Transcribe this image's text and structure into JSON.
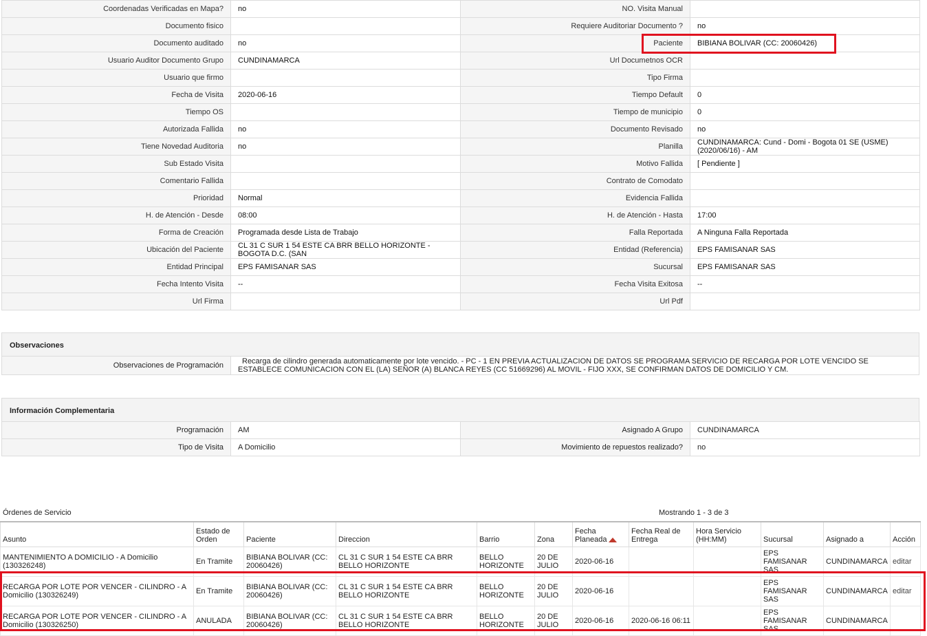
{
  "detail": {
    "rows": [
      [
        "Coordenadas Verificadas en Mapa?",
        "no",
        "NO. Visita Manual",
        ""
      ],
      [
        "Documento fisico",
        "",
        "Requiere Auditoriar Documento ?",
        "no"
      ],
      [
        "Documento auditado",
        "no",
        "Paciente",
        "BIBIANA BOLIVAR (CC: 20060426)"
      ],
      [
        "Usuario Auditor Documento Grupo",
        "CUNDINAMARCA",
        "Url Documetnos OCR",
        ""
      ],
      [
        "Usuario que firmo",
        "",
        "Tipo Firma",
        ""
      ],
      [
        "Fecha de Visita",
        "2020-06-16",
        "Tiempo Default",
        "0"
      ],
      [
        "Tiempo OS",
        "",
        "Tiempo de municipio",
        "0"
      ],
      [
        "Autorizada Fallida",
        "no",
        "Documento Revisado",
        "no"
      ],
      [
        "Tiene Novedad Auditoria",
        "no",
        "Planilla",
        "CUNDINAMARCA: Cund - Domi - Bogota 01 SE (USME) (2020/06/16) - AM"
      ],
      [
        "Sub Estado Visita",
        "",
        "Motivo Fallida",
        "[ Pendiente ]"
      ],
      [
        "Comentario Fallida",
        "",
        "Contrato de Comodato",
        ""
      ],
      [
        "Prioridad",
        "Normal",
        "Evidencia Fallida",
        ""
      ],
      [
        "H. de Atención - Desde",
        "08:00",
        "H. de Atención - Hasta",
        "17:00"
      ],
      [
        "Forma de Creación",
        "Programada desde Lista de Trabajo",
        "Falla Reportada",
        "A Ninguna Falla Reportada"
      ],
      [
        "Ubicación del Paciente",
        "CL 31 C SUR 1 54 ESTE CA BRR BELLO HORIZONTE - BOGOTA D.C. (SAN",
        "Entidad (Referencia)",
        "EPS FAMISANAR SAS"
      ],
      [
        "Entidad Principal",
        "EPS FAMISANAR SAS",
        "Sucursal",
        "EPS FAMISANAR SAS"
      ],
      [
        "Fecha Intento Visita",
        "--",
        "Fecha Visita Exitosa",
        "--"
      ],
      [
        "Url Firma",
        "",
        "Url Pdf",
        ""
      ]
    ]
  },
  "observaciones": {
    "title": "Observaciones",
    "label": "Observaciones de Programación",
    "value": "Recarga de cilindro generada automaticamente por lote vencido. - PC - 1 EN PREVIA ACTUALIZACION DE DATOS SE PROGRAMA SERVICIO DE RECARGA POR LOTE VENCIDO SE ESTABLECE COMUNICACION CON EL (LA) SEÑOR (A) BLANCA REYES (CC 51669296) AL MOVIL - FIJO XXX, SE CONFIRMAN DATOS DE DOMICILIO Y CM."
  },
  "complementaria": {
    "title": "Información Complementaria",
    "rows": [
      [
        "Programación",
        "AM",
        "Asignado A Grupo",
        "CUNDINAMARCA"
      ],
      [
        "Tipo de Visita",
        "A Domicilio",
        "Movimiento de repuestos realizado?",
        "no"
      ]
    ]
  },
  "orders": {
    "title": "Órdenes de Servicio",
    "count": "Mostrando 1 - 3 de 3",
    "headers": [
      "Asunto",
      "Estado de Orden",
      "Paciente",
      "Direccion",
      "Barrio",
      "Zona",
      "Fecha Planeada",
      "Fecha Real de Entrega",
      "Hora Servicio (HH:MM)",
      "Sucursal",
      "Asignado a",
      "Acción"
    ],
    "rows": [
      [
        "MANTENIMIENTO A DOMICILIO - A Domicilio (130326248)",
        "En Tramite",
        "BIBIANA BOLIVAR (CC: 20060426)",
        "CL 31 C SUR 1 54 ESTE CA BRR BELLO HORIZONTE",
        "BELLO HORIZONTE",
        "20 DE JULIO",
        "2020-06-16",
        "",
        "",
        "EPS FAMISANAR SAS",
        "CUNDINAMARCA",
        "editar"
      ],
      [
        "RECARGA POR LOTE POR VENCER - CILINDRO - A Domicilio (130326249)",
        "En Tramite",
        "BIBIANA BOLIVAR (CC: 20060426)",
        "CL 31 C SUR 1 54 ESTE CA BRR BELLO HORIZONTE",
        "BELLO HORIZONTE",
        "20 DE JULIO",
        "2020-06-16",
        "",
        "",
        "EPS FAMISANAR SAS",
        "CUNDINAMARCA",
        "editar"
      ],
      [
        "RECARGA POR LOTE POR VENCER - CILINDRO - A Domicilio (130326250)",
        "ANULADA",
        "BIBIANA BOLIVAR (CC: 20060426)",
        "CL 31 C SUR 1 54 ESTE CA BRR BELLO HORIZONTE",
        "BELLO HORIZONTE",
        "20 DE JULIO",
        "2020-06-16",
        "2020-06-16 06:11",
        "",
        "EPS FAMISANAR SAS",
        "CUNDINAMARCA",
        ""
      ]
    ]
  },
  "highlight_color": "#e0121f"
}
